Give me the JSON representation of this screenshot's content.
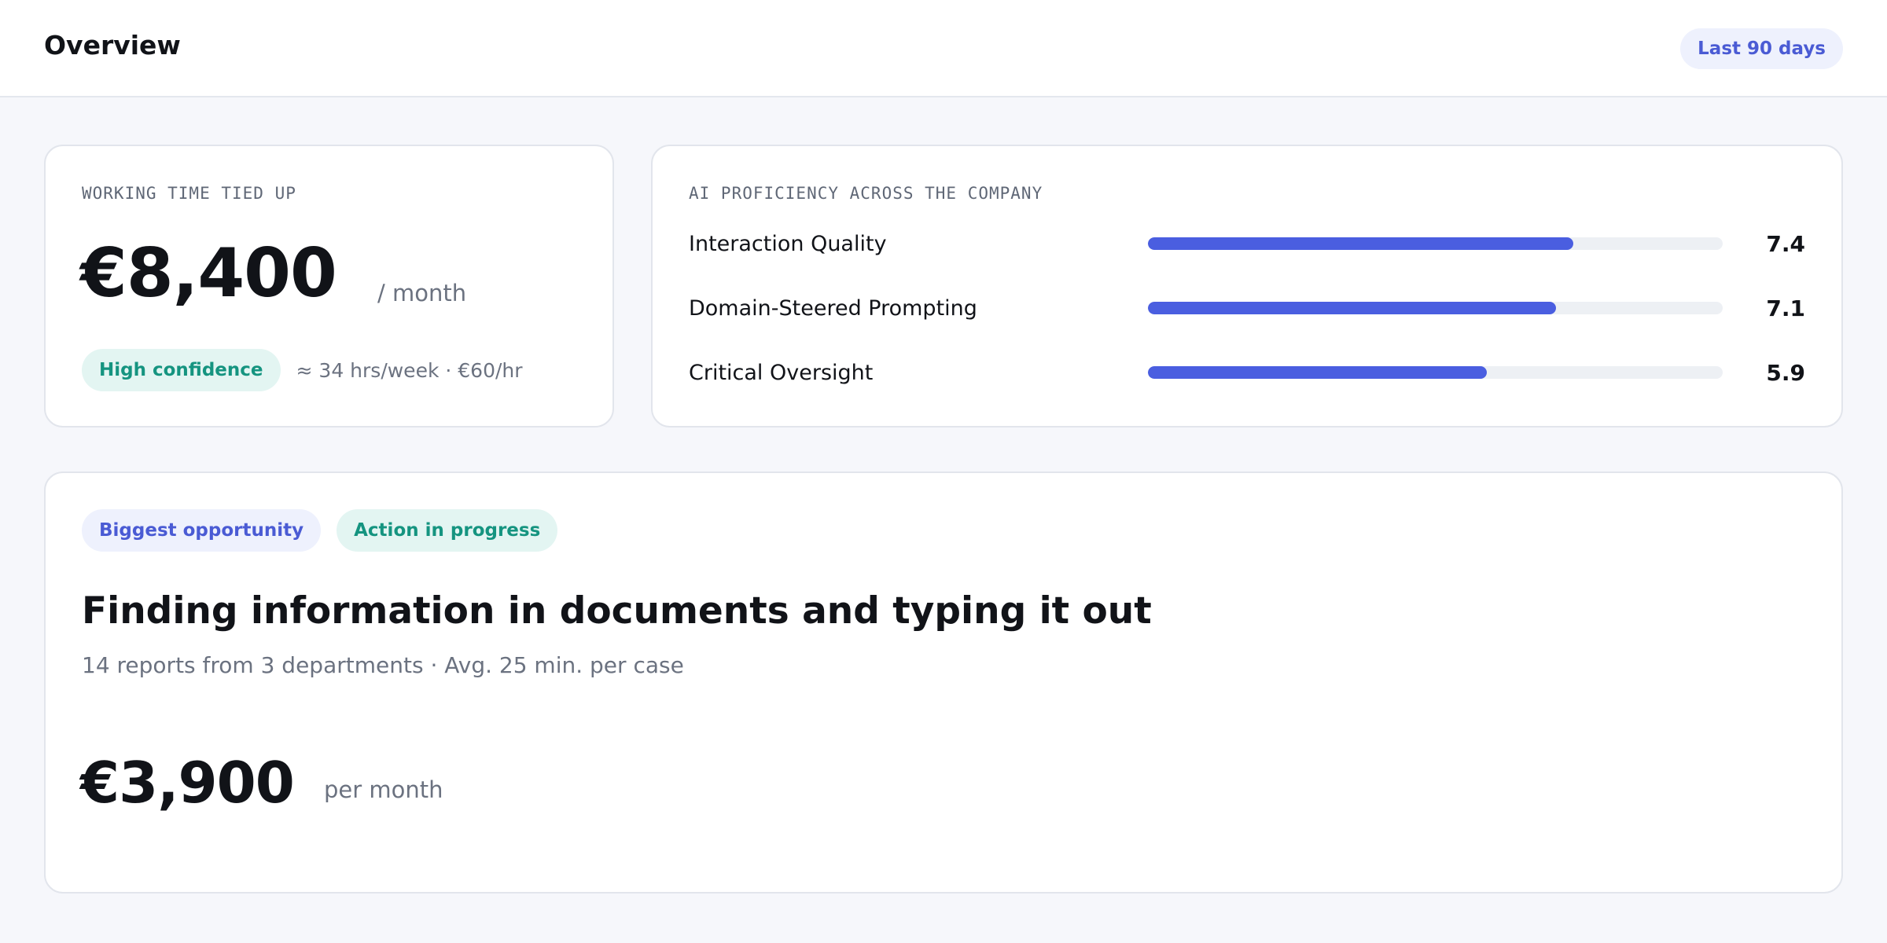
{
  "header": {
    "title": "Overview",
    "range_label": "Last 90 days"
  },
  "time_card": {
    "eyebrow": "WORKING TIME TIED UP",
    "amount": "€8,400",
    "unit": "/ month",
    "confidence": "High confidence",
    "note": "≈ 34 hrs/week · €60/hr"
  },
  "proficiency_card": {
    "eyebrow": "AI PROFICIENCY ACROSS THE COMPANY",
    "scale_max": 10,
    "metrics": [
      {
        "label": "Interaction Quality",
        "value": 7.4,
        "display": "7.4"
      },
      {
        "label": "Domain-Steered Prompting",
        "value": 7.1,
        "display": "7.1"
      },
      {
        "label": "Critical Oversight",
        "value": 5.9,
        "display": "5.9"
      }
    ],
    "colors": {
      "fill": "#4a5ee0",
      "track": "#edf0f4"
    }
  },
  "opportunity_card": {
    "tags": [
      "Biggest opportunity",
      "Action in progress"
    ],
    "title": "Finding information in documents and typing it out",
    "subtitle": "14 reports from 3 departments · Avg. 25 min. per case",
    "amount": "€3,900",
    "unit": "per month"
  }
}
